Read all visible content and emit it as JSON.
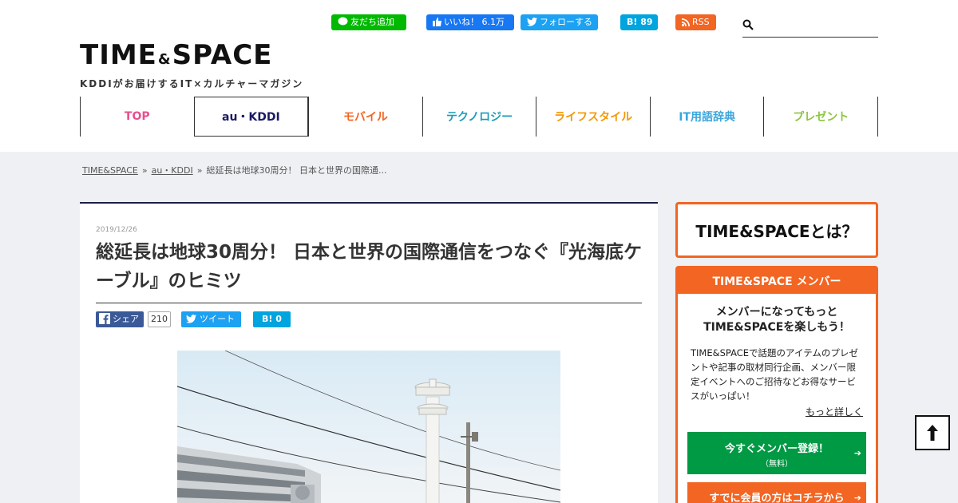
{
  "header": {
    "logo": {
      "main_left": "TIME",
      "amp": "&",
      "main_right": "SPACE",
      "tagline": "KDDIがお届けするIT×カルチャーマガジン"
    },
    "social": {
      "line": "友だち追加",
      "facebook": "いいね！ 6.1万",
      "twitter": "フォローする",
      "hatena": "B! 89",
      "rss": "RSS"
    },
    "search": {
      "placeholder": "",
      "value": ""
    },
    "nav": [
      {
        "label": "TOP",
        "color": "#e8508d"
      },
      {
        "label": "au・KDDI",
        "color": "#1a1a66"
      },
      {
        "label": "モバイル",
        "color": "#f26522"
      },
      {
        "label": "テクノロジー",
        "color": "#1b9bb8"
      },
      {
        "label": "ライフスタイル",
        "color": "#f39800"
      },
      {
        "label": "IT用語辞典",
        "color": "#3aa6dd"
      },
      {
        "label": "プレゼント",
        "color": "#8cc63f"
      }
    ]
  },
  "breadcrumb": {
    "items": [
      "TIME&SPACE",
      "au・KDDI",
      "総延長は地球30周分！ 日本と世界の国際通..."
    ],
    "separator": "»"
  },
  "article": {
    "date": "2019/12/26",
    "title": "総延長は地球30周分！ 日本と世界の国際通信をつなぐ『光海底ケーブル』のヒミツ",
    "share": {
      "facebook": "シェア",
      "facebook_count": "210",
      "twitter": "ツイート",
      "hatena": "B!  0"
    }
  },
  "sidebar": {
    "about": "TIME&SPACEとは？",
    "member": {
      "heading": "TIME&SPACE メンバー",
      "lead_line1": "メンバーになってもっと",
      "lead_line2": "TIME&SPACEを楽しもう！",
      "description": "TIME&SPACEで話題のアイテムのプレゼントや記事の取材同行企画、メンバー限定イベントへのご招待などお得なサービスがいっぱい！",
      "more": "もっと詳しく",
      "register_label": "今すぐメンバー登録！",
      "register_note": "（無料）",
      "login_label": "すでに会員の方はコチラから"
    }
  },
  "colors": {
    "accent": "#f26522",
    "member_green": "#009944",
    "navy": "#1f1f4a",
    "gray_bg": "#eef0f3"
  }
}
